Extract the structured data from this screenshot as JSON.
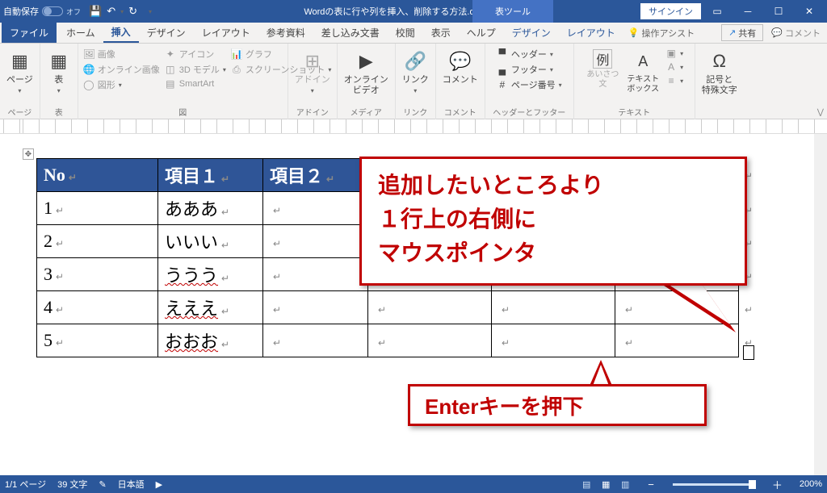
{
  "titlebar": {
    "autosave_label": "自動保存",
    "autosave_state": "オフ",
    "doc_title": "Wordの表に行や列を挿入、削除する方法.docx",
    "context_tool": "表ツール",
    "signin": "サインイン"
  },
  "tabs": {
    "file": "ファイル",
    "home": "ホーム",
    "insert": "挿入",
    "design_doc": "デザイン",
    "layout_doc": "レイアウト",
    "references": "参考資料",
    "mailings": "差し込み文書",
    "review": "校閲",
    "view": "表示",
    "help": "ヘルプ",
    "table_design": "デザイン",
    "table_layout": "レイアウト",
    "tell_me": "操作アシスト",
    "share": "共有",
    "comment": "コメント"
  },
  "ribbon": {
    "pages": {
      "label": "ページ",
      "btn": "ページ"
    },
    "tables": {
      "label": "表",
      "btn": "表"
    },
    "illustrations": {
      "label": "図",
      "items": [
        "画像",
        "オンライン画像",
        "図形",
        "アイコン",
        "3D モデル",
        "SmartArt",
        "グラフ",
        "スクリーンショット"
      ]
    },
    "addins": {
      "label": "アドイン",
      "btn": "アドイン"
    },
    "media": {
      "label": "メディア",
      "btn": "オンライン\nビデオ"
    },
    "links": {
      "label": "リンク",
      "btn": "リンク"
    },
    "comments": {
      "label": "コメント",
      "btn": "コメント"
    },
    "headerfooter": {
      "label": "ヘッダーとフッター",
      "items": [
        "ヘッダー",
        "フッター",
        "ページ番号"
      ]
    },
    "text": {
      "label": "テキスト",
      "greet": "あいさつ\n文",
      "textbox": "テキスト\nボックス",
      "items": [
        "例"
      ]
    },
    "symbols": {
      "label": "記号と\n特殊文字",
      "btn": "記号と\n特殊文字"
    }
  },
  "table": {
    "headers": [
      "No",
      "項目１",
      "項目２",
      "",
      "",
      ""
    ],
    "rows": [
      [
        "1",
        "あああ",
        "",
        "",
        "",
        ""
      ],
      [
        "2",
        "いいい",
        "",
        "",
        "",
        ""
      ],
      [
        "3",
        "ううう",
        "",
        "",
        "",
        ""
      ],
      [
        "4",
        "えええ",
        "",
        "",
        "",
        ""
      ],
      [
        "5",
        "おおお",
        "",
        "",
        "",
        ""
      ]
    ]
  },
  "callouts": {
    "c1_line1": "追加したいところより",
    "c1_line2": "１行上の右側に",
    "c1_line3": "マウスポインタ",
    "c2": "Enterキーを押下"
  },
  "statusbar": {
    "page": "1/1 ページ",
    "words": "39 文字",
    "lang_icon": "",
    "lang": "日本語",
    "zoom": "200%"
  }
}
